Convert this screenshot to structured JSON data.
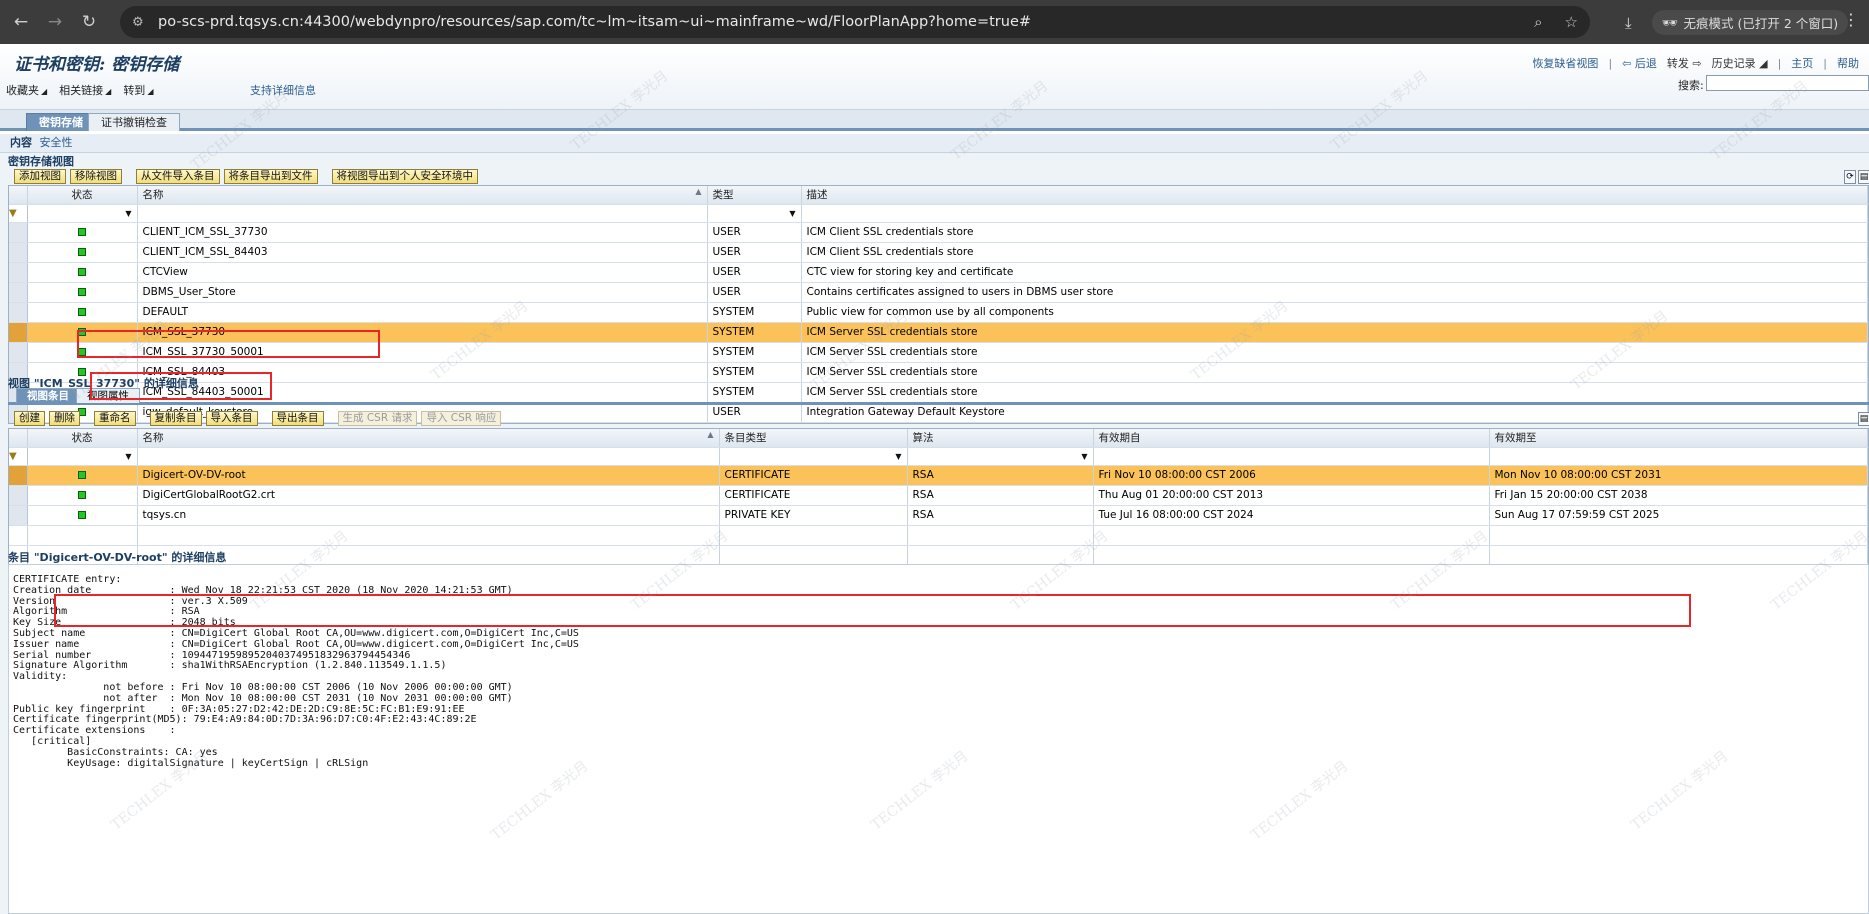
{
  "browser": {
    "url": "po-scs-prd.tqsys.cn:44300/webdynpro/resources/sap.com/tc~lm~itsam~ui~mainframe~wd/FloorPlanApp?home=true#",
    "incognito_label": "无痕模式 (已打开 2 个窗口)"
  },
  "header": {
    "title": "证书和密钥: 密钥存储",
    "links": {
      "restore_view": "恢复缺省视图",
      "back": "后退",
      "forward": "转发",
      "history": "历史记录",
      "home": "主页",
      "help": "帮助"
    },
    "menu": [
      "收藏夹",
      "相关链接",
      "转到"
    ],
    "support": "支持详细信息",
    "search_label": "搜索:"
  },
  "tabs": [
    "密钥存储",
    "证书撤销检查"
  ],
  "content_bar": {
    "label": "内容",
    "link": "安全性"
  },
  "keystore": {
    "title": "密钥存储视图",
    "toolbar": [
      "添加视图",
      "移除视图",
      "从文件导入条目",
      "将条目导出到文件",
      "将视图导出到个人安全环境中"
    ],
    "columns": [
      "状态",
      "名称",
      "类型",
      "描述"
    ],
    "rows": [
      {
        "name": "CLIENT_ICM_SSL_37730",
        "type": "USER",
        "desc": "ICM Client SSL credentials store"
      },
      {
        "name": "CLIENT_ICM_SSL_84403",
        "type": "USER",
        "desc": "ICM Client SSL credentials store"
      },
      {
        "name": "CTCView",
        "type": "USER",
        "desc": "CTC view for storing key and certificate"
      },
      {
        "name": "DBMS_User_Store",
        "type": "USER",
        "desc": "Contains certificates assigned to users in DBMS user store"
      },
      {
        "name": "DEFAULT",
        "type": "SYSTEM",
        "desc": "Public view for common use by all components"
      },
      {
        "name": "ICM_SSL_37730",
        "type": "SYSTEM",
        "desc": "ICM Server SSL credentials store",
        "selected": true
      },
      {
        "name": "ICM_SSL_37730_50001",
        "type": "SYSTEM",
        "desc": "ICM Server SSL credentials store"
      },
      {
        "name": "ICM_SSL_84403",
        "type": "SYSTEM",
        "desc": "ICM Server SSL credentials store"
      },
      {
        "name": "ICM_SSL_84403_50001",
        "type": "SYSTEM",
        "desc": "ICM Server SSL credentials store"
      },
      {
        "name": "igw_default_keystore",
        "type": "USER",
        "desc": "Integration Gateway Default Keystore"
      }
    ]
  },
  "view_detail": {
    "title": "视图 \"ICM_SSL_37730\" 的详细信息",
    "tabs": [
      "视图条目",
      "视图属性"
    ],
    "toolbar": [
      "创建",
      "删除",
      "重命名",
      "复制条目",
      "导入条目",
      "导出条目",
      "生成 CSR 请求",
      "导入 CSR 响应"
    ],
    "columns": [
      "状态",
      "名称",
      "条目类型",
      "算法",
      "有效期自",
      "有效期至"
    ],
    "rows": [
      {
        "name": "Digicert-OV-DV-root",
        "type": "CERTIFICATE",
        "alg": "RSA",
        "from": "Fri Nov 10 08:00:00 CST 2006",
        "to": "Mon Nov 10 08:00:00 CST 2031",
        "selected": true
      },
      {
        "name": "DigiCertGlobalRootG2.crt",
        "type": "CERTIFICATE",
        "alg": "RSA",
        "from": "Thu Aug 01 20:00:00 CST 2013",
        "to": "Fri Jan 15 20:00:00 CST 2038"
      },
      {
        "name": "tqsys.cn",
        "type": "PRIVATE KEY",
        "alg": "RSA",
        "from": "Tue Jul 16 08:00:00 CST 2024",
        "to": "Sun Aug 17 07:59:59 CST 2025"
      }
    ]
  },
  "entry_detail": {
    "title": "条目 \"Digicert-OV-DV-root\" 的详细信息",
    "text": "CERTIFICATE entry:\nCreation date             : Wed Nov 18 22:21:53 CST 2020 (18 Nov 2020 14:21:53 GMT)\nVersion                   : ver.3 X.509\nAlgorithm                 : RSA\nKey Size                  : 2048 bits\nSubject name              : CN=DigiCert Global Root CA,OU=www.digicert.com,O=DigiCert Inc,C=US\nIssuer name               : CN=DigiCert Global Root CA,OU=www.digicert.com,O=DigiCert Inc,C=US\nSerial number             : 10944719598952040374951832963794454346\nSignature Algorithm       : sha1WithRSAEncryption (1.2.840.113549.1.1.5)\nValidity:\n               not before : Fri Nov 10 08:00:00 CST 2006 (10 Nov 2006 00:00:00 GMT)\n               not after  : Mon Nov 10 08:00:00 CST 2031 (10 Nov 2031 00:00:00 GMT)\nPublic key fingerprint    : 0F:3A:05:27:D2:42:DE:2D:C9:8E:5C:FC:B1:E9:91:EE\nCertificate fingerprint(MD5): 79:E4:A9:84:0D:7D:3A:96:D7:C0:4F:E2:43:4C:89:2E\nCertificate extensions    :\n   [critical]\n         BasicConstraints: CA: yes\n         KeyUsage: digitalSignature | keyCertSign | cRLSign"
  },
  "watermark": "TECHLEX 李光月"
}
